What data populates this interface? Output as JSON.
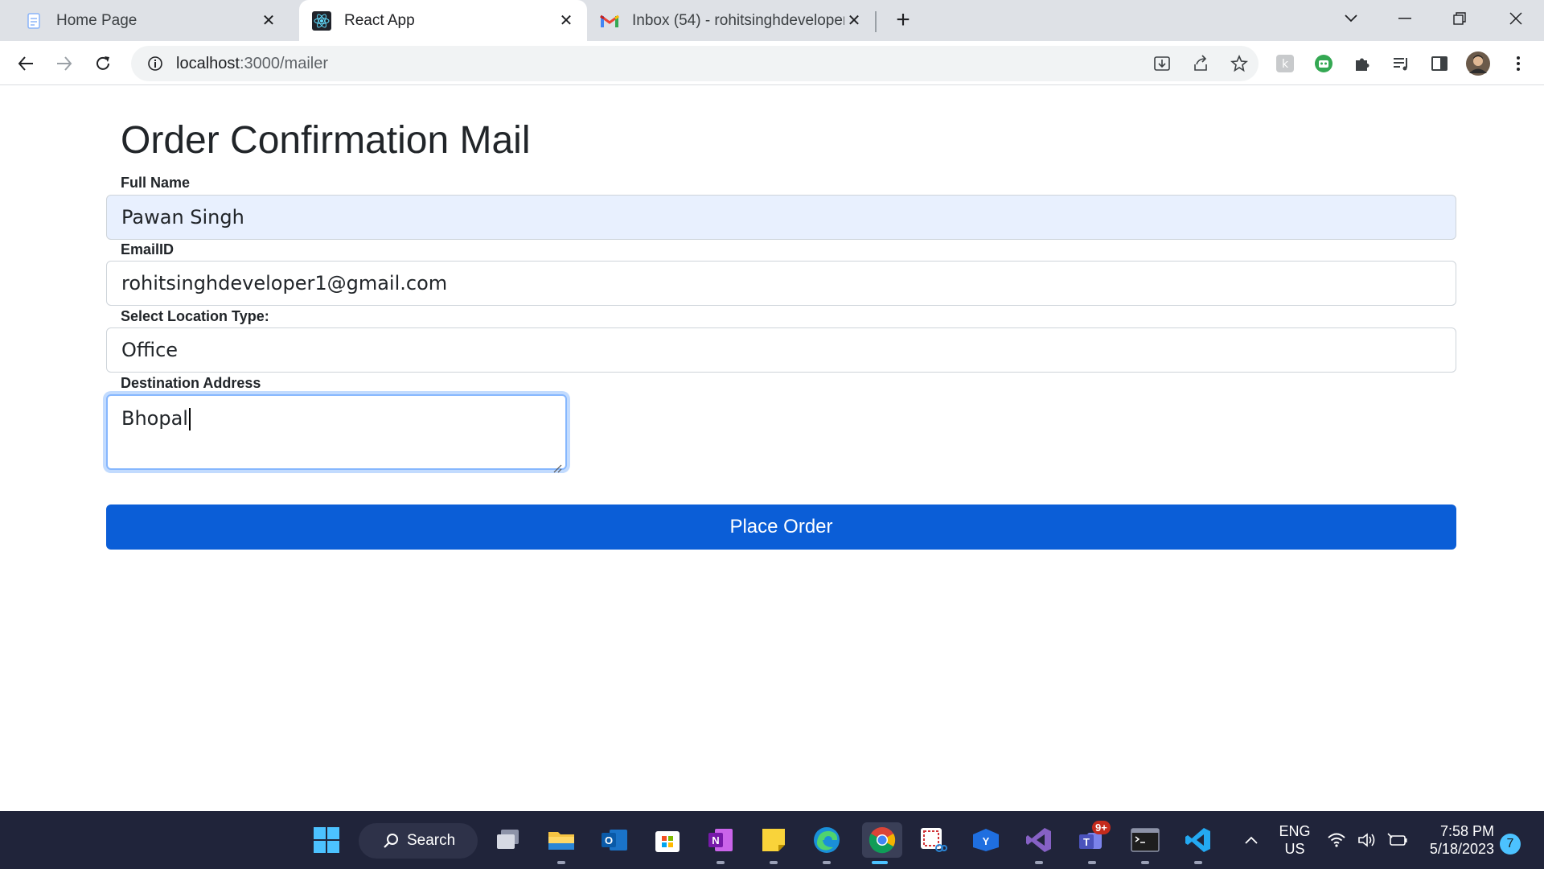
{
  "browser": {
    "tabs": [
      {
        "title": "Home Page",
        "icon": "document-icon",
        "active": false
      },
      {
        "title": "React App",
        "icon": "react-icon",
        "active": true
      },
      {
        "title": "Inbox (54) - rohitsinghdeveloper1",
        "icon": "gmail-icon",
        "active": false
      }
    ],
    "new_tab": "+",
    "url_host": "localhost",
    "url_path": ":3000/mailer"
  },
  "form": {
    "heading": "Order Confirmation Mail",
    "full_name_label": "Full Name",
    "full_name_value": "Pawan Singh",
    "email_label": "EmailID",
    "email_value": "rohitsinghdeveloper1@gmail.com",
    "location_label": "Select Location Type:",
    "location_value": "Office",
    "address_label": "Destination Address",
    "address_value": "Bhopal",
    "submit_label": "Place Order"
  },
  "taskbar": {
    "search_label": "Search",
    "teams_badge": "9+",
    "language": "ENG",
    "region": "US",
    "time": "7:58 PM",
    "date": "5/18/2023",
    "notifications": "7"
  },
  "colors": {
    "primary_button": "#0b5ed7",
    "autofill_bg": "#e8f0fe",
    "focus_ring": "#86b7fe",
    "taskbar_bg": "#20243a"
  }
}
